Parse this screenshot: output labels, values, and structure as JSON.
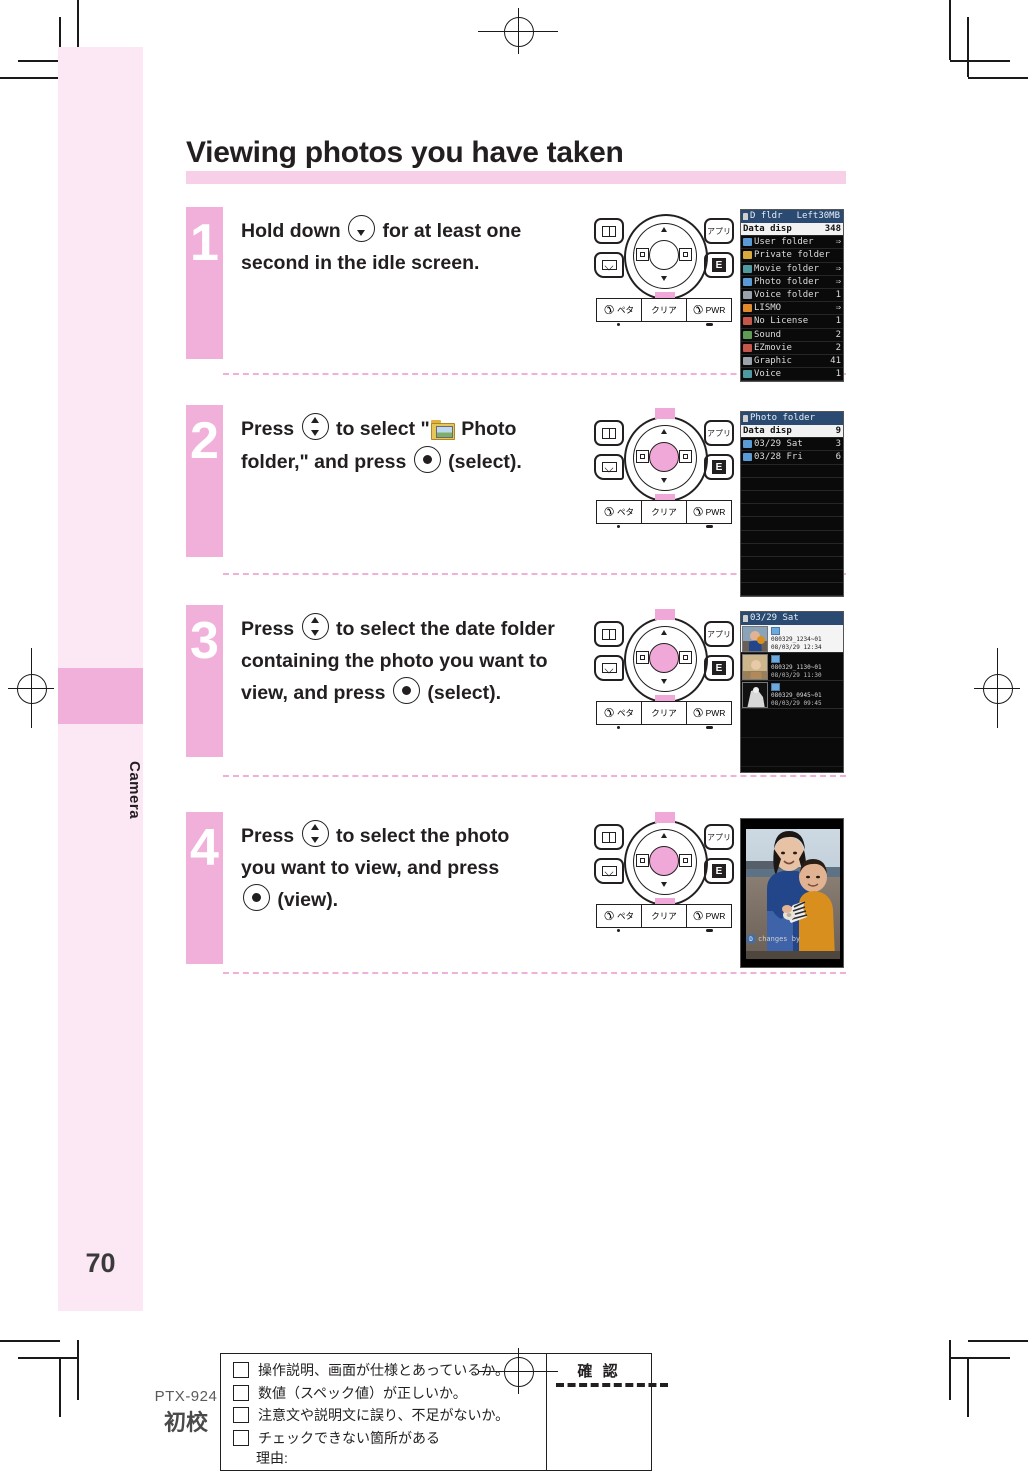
{
  "page": {
    "heading": "Viewing photos you have taken",
    "side_tab": "Camera",
    "page_number": "70"
  },
  "steps": [
    {
      "number": "1",
      "text_parts": [
        "Hold down ",
        "KEY_DOWN",
        " for at least one second in the idle screen."
      ],
      "line1_a": "Hold down",
      "line1_b": "for at least one",
      "line2": "second in the idle screen.",
      "keypad": {
        "center_on": false,
        "hl_top": false,
        "hl_bottom": true
      }
    },
    {
      "number": "2",
      "line1_a": "Press",
      "line1_b": "to select \"",
      "line1_c": "Photo",
      "line2_a": "folder,\" and press",
      "line2_b": "(select).",
      "keypad": {
        "center_on": true,
        "hl_top": true,
        "hl_bottom": true
      }
    },
    {
      "number": "3",
      "line1_a": "Press",
      "line1_b": "to select the date folder",
      "line2": "containing the photo you want to",
      "line3_a": "view, and press",
      "line3_b": "(select).",
      "keypad": {
        "center_on": true,
        "hl_top": true,
        "hl_bottom": true
      }
    },
    {
      "number": "4",
      "line1_a": "Press",
      "line1_b": "to select the photo",
      "line2": "you want to view, and press",
      "line3": "(view).",
      "keypad": {
        "center_on": true,
        "hl_top": true,
        "hl_bottom": true
      }
    }
  ],
  "keypad_labels": {
    "app": "アプリ",
    "e": "E",
    "call": "ペタ",
    "clear": "クリア",
    "power": "PWR"
  },
  "lcd_screens": {
    "data_folder": {
      "title": "D fldr",
      "title_right": "Left30MB",
      "rows": [
        {
          "label": "Data disp",
          "count": "348",
          "selected": true,
          "icon": null
        },
        {
          "label": "User folder",
          "count": "⇒",
          "icon": "blue"
        },
        {
          "label": "Private folder",
          "count": "",
          "icon": "gold"
        },
        {
          "label": "Movie folder",
          "count": "⇒",
          "icon": "teal"
        },
        {
          "label": "Photo folder",
          "count": "⇒",
          "icon": "blue"
        },
        {
          "label": "Voice folder",
          "count": "1",
          "icon": "gray"
        },
        {
          "label": "LISMO",
          "count": "⇒",
          "icon": "orange"
        },
        {
          "label": "No License",
          "count": "1",
          "icon": "red"
        },
        {
          "label": "Sound",
          "count": "2",
          "icon": "green"
        },
        {
          "label": "EZmovie",
          "count": "2",
          "icon": "red"
        },
        {
          "label": "Graphic",
          "count": "41",
          "icon": "gray"
        },
        {
          "label": "Voice",
          "count": "1",
          "icon": "teal"
        }
      ]
    },
    "photo_folder": {
      "title": "Photo folder",
      "rows": [
        {
          "label": "Data disp",
          "count": "9",
          "selected": true,
          "icon": null
        },
        {
          "label": "03/29 Sat",
          "count": "3",
          "icon": "blue"
        },
        {
          "label": "03/28 Fri",
          "count": "6",
          "icon": "blue"
        }
      ],
      "empty_rows": 10
    },
    "date_folder": {
      "title": "03/29 Sat",
      "items": [
        {
          "filename": "080329_1234~01",
          "datetime": "08/03/29 12:34",
          "selected": true
        },
        {
          "filename": "080329_1130~01",
          "datetime": "08/03/29 11:30",
          "selected": false
        },
        {
          "filename": "080329_0945~01",
          "datetime": "08/03/29 09:45",
          "selected": false
        }
      ],
      "empty_rows": 2
    },
    "photo_view": {
      "tag_badge": "D",
      "tag_text": "changes by"
    }
  },
  "proof": {
    "code": "PTX-924",
    "stage": "初校",
    "items": [
      "操作説明、画面が仕様とあっているか。",
      "数値（スペック値）が正しいか。",
      "注意文や説明文に誤り、不足がないか。",
      "チェックできない箇所がある"
    ],
    "reason_label": "理由:",
    "approve_label": "確 認"
  }
}
